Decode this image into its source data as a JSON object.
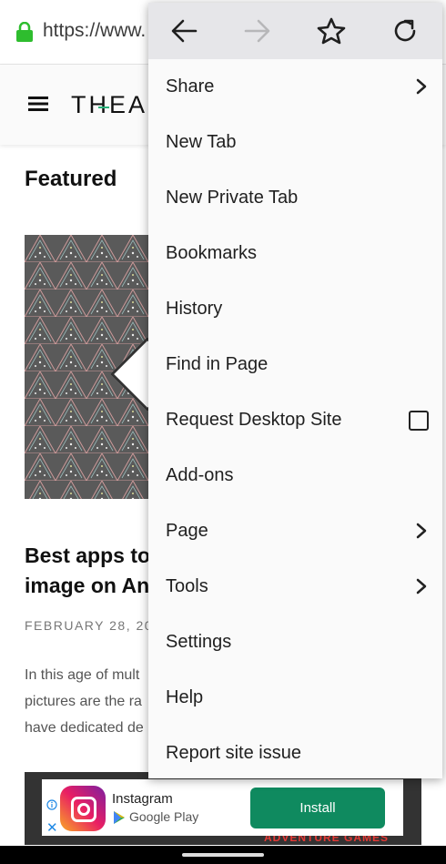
{
  "browser": {
    "url": "https://www."
  },
  "site": {
    "logo_text": "THEAN",
    "section_heading": "Featured",
    "article": {
      "title_line1": "Best apps to",
      "title_line2": "image on An",
      "date": "FEBRUARY 28, 20",
      "excerpt_line1": "In this age of mult",
      "excerpt_line2": "pictures are the ra",
      "excerpt_line3": "have dedicated de"
    }
  },
  "ad": {
    "app_name": "Instagram",
    "store": "Google Play",
    "install_label": "Install",
    "close_glyph": "✕",
    "strip_text": "ADVENTURE GAMES"
  },
  "menu": {
    "toolbar": [
      "back-icon",
      "forward-icon",
      "bookmark-star-icon",
      "reload-icon"
    ],
    "items": [
      {
        "label": "Share",
        "trailing": "chevron"
      },
      {
        "label": "New Tab",
        "trailing": ""
      },
      {
        "label": "New Private Tab",
        "trailing": ""
      },
      {
        "label": "Bookmarks",
        "trailing": ""
      },
      {
        "label": "History",
        "trailing": ""
      },
      {
        "label": "Find in Page",
        "trailing": ""
      },
      {
        "label": "Request Desktop Site",
        "trailing": "checkbox",
        "checked": false
      },
      {
        "label": "Add-ons",
        "trailing": ""
      },
      {
        "label": "Page",
        "trailing": "chevron"
      },
      {
        "label": "Tools",
        "trailing": "chevron"
      },
      {
        "label": "Settings",
        "trailing": ""
      },
      {
        "label": "Help",
        "trailing": ""
      },
      {
        "label": "Report site issue",
        "trailing": ""
      }
    ]
  },
  "colors": {
    "lock": "#2ebd2e",
    "install_button": "#0f8a5f",
    "menu_toolbar": "#e6e6e9",
    "logo_accent": "#2ab27b"
  }
}
